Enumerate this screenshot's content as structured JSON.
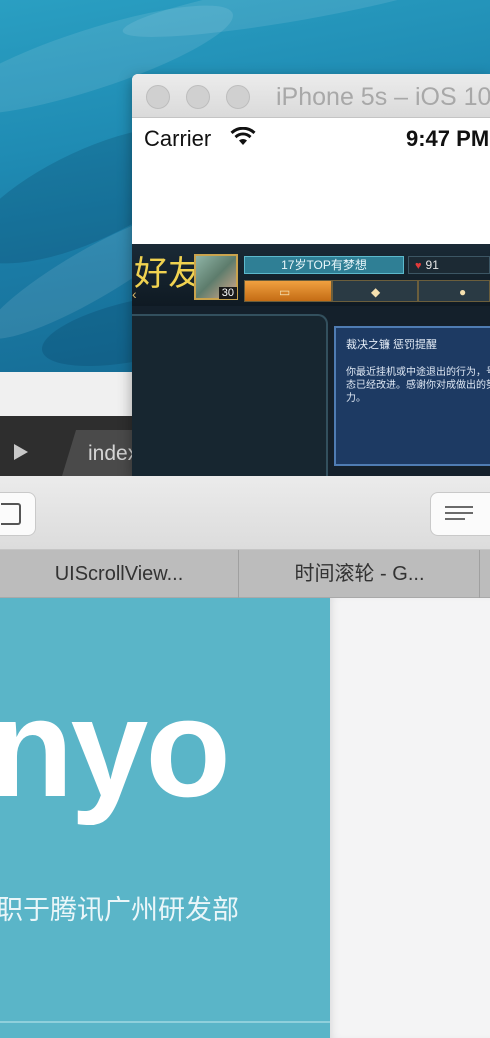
{
  "simulator": {
    "title": "iPhone 5s – iOS 10",
    "status": {
      "carrier": "Carrier",
      "time": "9:47 PM"
    },
    "game": {
      "friends_label": "好友",
      "player_name": "17岁TOP有梦想",
      "heart_count": "91",
      "level": "30",
      "notice_title": "裁决之镰 惩罚提醒",
      "notice_body": "你最近挂机或中途退出的行为，号状态已经改进。感谢你对成做出的努力。"
    }
  },
  "editor": {
    "tab_label": "index"
  },
  "browser": {
    "tabs": [
      {
        "label": "UIScrollView..."
      },
      {
        "label": "时间滚轮 - G..."
      }
    ]
  },
  "page": {
    "hero_word": "nyo",
    "hero_subtitle": "职于腾讯广州研发部"
  },
  "colors": {
    "hero_bg": "#5ab5c8",
    "wallpaper": "#1f8bb3",
    "game_accent": "#f0d250"
  }
}
